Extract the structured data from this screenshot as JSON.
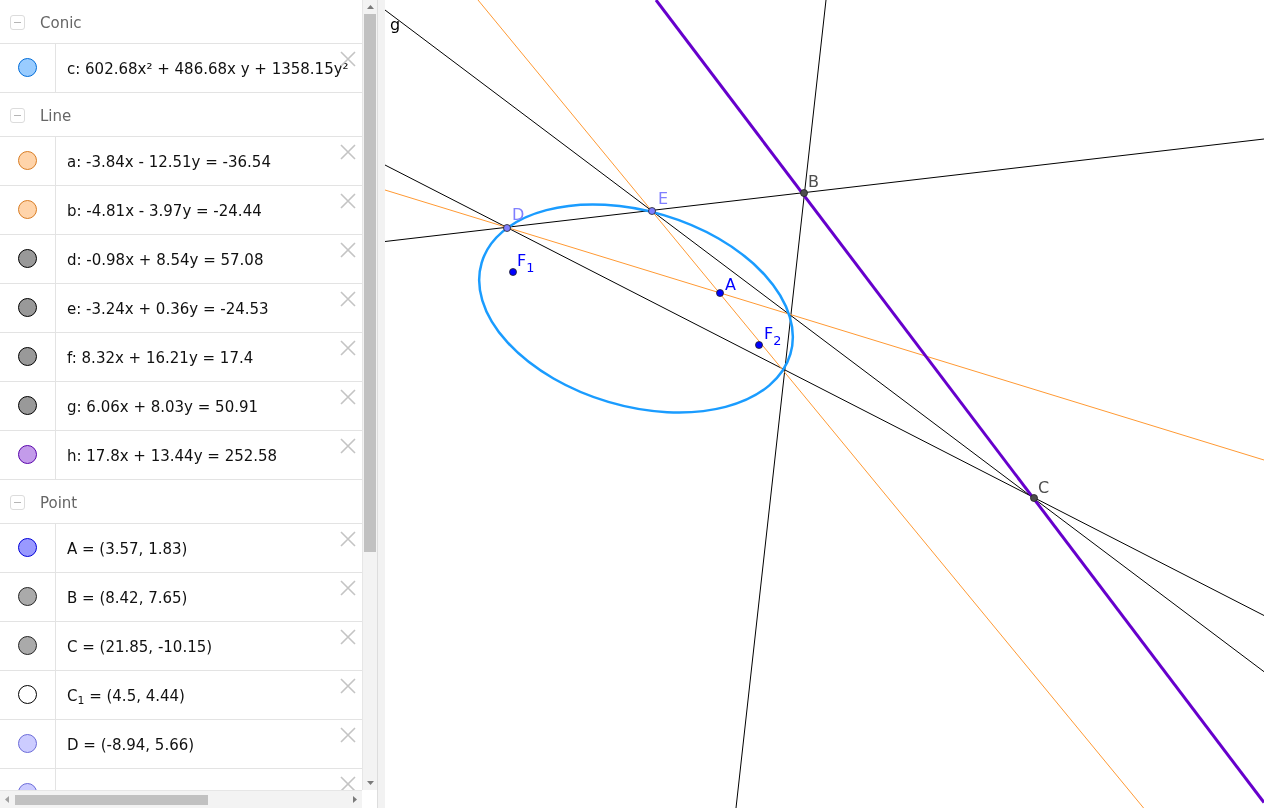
{
  "algebra_view": {
    "groups": [
      {
        "title": "Conic",
        "expanded": true,
        "items": [
          {
            "text": "c: 602.68x² + 486.68x y + 1358.15y²",
            "visible": true,
            "color": "#99ccff"
          }
        ]
      },
      {
        "title": "Line",
        "expanded": true,
        "items": [
          {
            "text": "a: -3.84x - 12.51y = -36.54",
            "visible": true,
            "color": "#ffd4aa"
          },
          {
            "text": "b: -4.81x - 3.97y = -24.44",
            "visible": true,
            "color": "#ffd4aa"
          },
          {
            "text": "d: -0.98x + 8.54y = 57.08",
            "visible": true,
            "color": "#999999"
          },
          {
            "text": "e: -3.24x + 0.36y = -24.53",
            "visible": true,
            "color": "#999999"
          },
          {
            "text": "f: 8.32x + 16.21y = 17.4",
            "visible": true,
            "color": "#999999"
          },
          {
            "text": "g: 6.06x + 8.03y = 50.91",
            "visible": true,
            "color": "#999999"
          },
          {
            "text": "h: 17.8x + 13.44y = 252.58",
            "visible": true,
            "color": "#c39bea"
          }
        ]
      },
      {
        "title": "Point",
        "expanded": true,
        "items": [
          {
            "text": "A = (3.57, 1.83)",
            "visible": true,
            "color": "#9999ff"
          },
          {
            "text": "B = (8.42, 7.65)",
            "visible": true,
            "color": "#aaaaaa"
          },
          {
            "text": "C = (21.85, -10.15)",
            "visible": true,
            "color": "#aaaaaa"
          },
          {
            "text": "C$_{1}$ = (4.5, 4.44)",
            "visible": false
          },
          {
            "text": "D = (-8.94, 5.66)",
            "visible": true,
            "color": "#ccccff"
          },
          {
            "visible": true,
            "color": "#ccccff"
          }
        ]
      }
    ]
  },
  "graphics_view": {
    "line_label": "g",
    "points": [
      {
        "label": "D",
        "color": "#7f7fff"
      },
      {
        "label": "E",
        "color": "#7f7fff"
      },
      {
        "label": "B",
        "color": "#4d4d4d"
      },
      {
        "label": "F$_{1}$",
        "color": "#0000ff"
      },
      {
        "label": "A",
        "color": "#0000ff"
      },
      {
        "label": "F$_{2}$",
        "color": "#0000ff"
      },
      {
        "label": "C",
        "color": "#4d4d4d"
      }
    ]
  }
}
